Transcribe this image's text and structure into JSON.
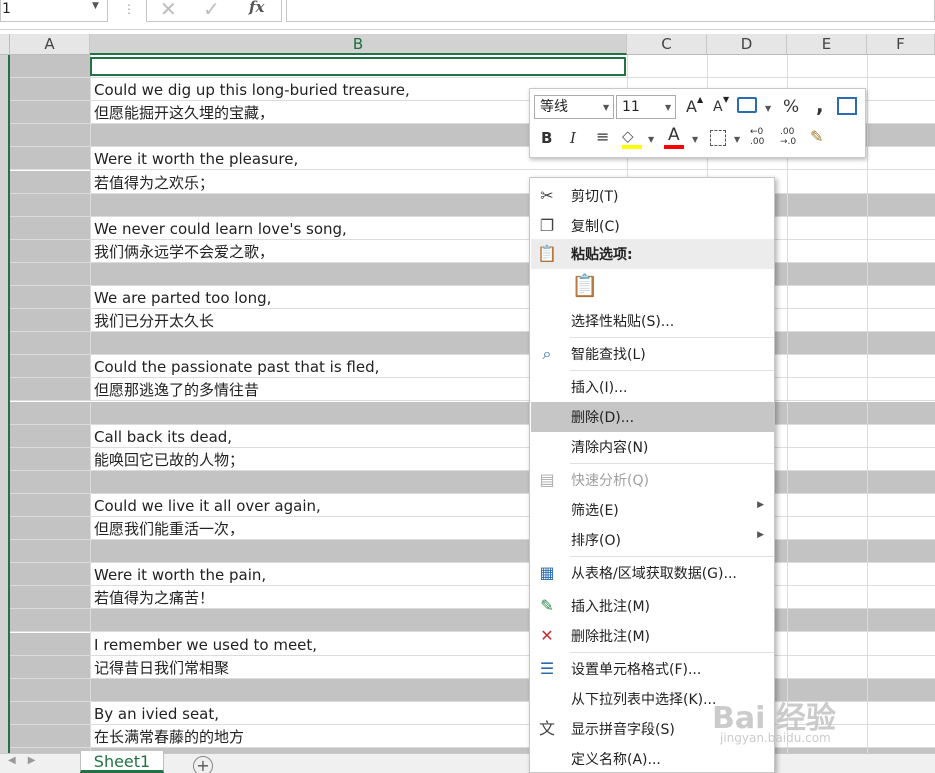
{
  "formula_bar": {
    "name_box": "1",
    "fx_label": "fx"
  },
  "columns": [
    "A",
    "B",
    "C",
    "D",
    "E",
    "F"
  ],
  "poem_lines": [
    {
      "en": "Could we dig up this long-buried treasure,",
      "zh": "但愿能掘开这久埋的宝藏，"
    },
    {
      "en": "Were it worth the pleasure,",
      "zh": "若值得为之欢乐；"
    },
    {
      "en": "We never could learn love's song,",
      "zh": "我们俩永远学不会爱之歌，"
    },
    {
      "en": "We are parted too long,",
      "zh": "我们已分开太久长"
    },
    {
      "en": "Could the passionate past that is fled,",
      "zh": "但愿那逃逸了的多情往昔"
    },
    {
      "en": "Call back its dead,",
      "zh": "能唤回它已故的人物；"
    },
    {
      "en": "Could we live it all over again,",
      "zh": "但愿我们能重活一次，"
    },
    {
      "en": "Were it worth the pain,",
      "zh": "若值得为之痛苦！"
    },
    {
      "en": "I remember we used to meet,",
      "zh": "记得昔日我们常相聚"
    },
    {
      "en": "By an ivied seat,",
      "zh": "在长满常春藤的的地方"
    }
  ],
  "mini_toolbar": {
    "font_name": "等线",
    "font_size": "11",
    "percent": "%",
    "comma": ",",
    "bold": "B",
    "italic": "I",
    "grow_font": "A",
    "shrink_font": "A",
    "font_color_letter": "A",
    "highlight_color": "#ffff00",
    "font_color": "#ff0000"
  },
  "context_menu": {
    "items": [
      {
        "label": "剪切(T)",
        "icon": "scissors-icon"
      },
      {
        "label": "复制(C)",
        "icon": "copy-icon"
      },
      {
        "label": "粘贴选项:",
        "icon": "paste-icon"
      },
      {
        "label": "",
        "icon": "paste-clipboard-icon"
      },
      {
        "label": "选择性粘贴(S)...",
        "icon": ""
      },
      {
        "label": "智能查找(L)",
        "icon": "smart-lookup-icon"
      },
      {
        "label": "插入(I)...",
        "icon": ""
      },
      {
        "label": "删除(D)...",
        "icon": ""
      },
      {
        "label": "清除内容(N)",
        "icon": ""
      },
      {
        "label": "快速分析(Q)",
        "icon": "quick-analysis-icon"
      },
      {
        "label": "筛选(E)",
        "icon": ""
      },
      {
        "label": "排序(O)",
        "icon": ""
      },
      {
        "label": "从表格/区域获取数据(G)...",
        "icon": "table-icon"
      },
      {
        "label": "插入批注(M)",
        "icon": "insert-comment-icon"
      },
      {
        "label": "删除批注(M)",
        "icon": "delete-comment-icon"
      },
      {
        "label": "设置单元格格式(F)...",
        "icon": "format-cells-icon"
      },
      {
        "label": "从下拉列表中选择(K)...",
        "icon": ""
      },
      {
        "label": "显示拼音字段(S)",
        "icon": "phonetic-icon"
      },
      {
        "label": "定义名称(A)...",
        "icon": ""
      }
    ]
  },
  "sheet_tabs": [
    "Sheet1"
  ],
  "watermark": {
    "main": "Bai 经验",
    "sub": "jingyan.baidu.com"
  }
}
